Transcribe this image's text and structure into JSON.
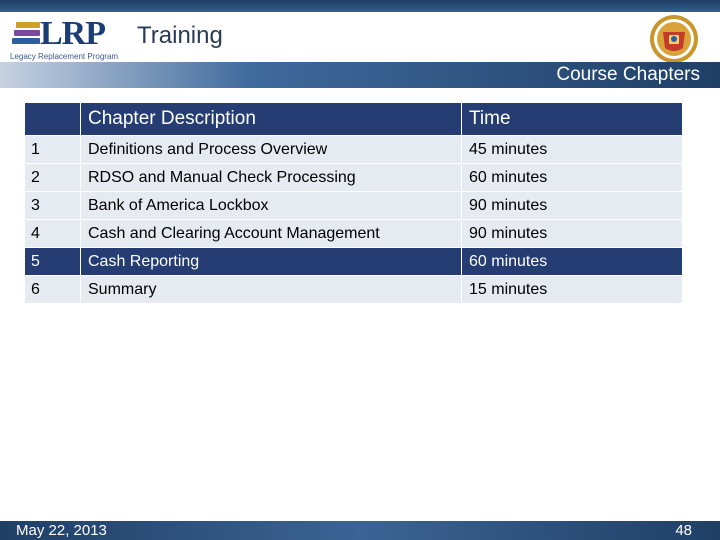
{
  "header": {
    "logo_text": "LRP",
    "logo_subtext": "Legacy Replacement Program",
    "title": "Training"
  },
  "subtitle": "Course Chapters",
  "table": {
    "columns": [
      "",
      "Chapter Description",
      "Time"
    ],
    "rows": [
      {
        "num": "1",
        "description": "Definitions and Process Overview",
        "time": "45 minutes"
      },
      {
        "num": "2",
        "description": "RDSO and Manual Check Processing",
        "time": "60 minutes"
      },
      {
        "num": "3",
        "description": "Bank of America Lockbox",
        "time": "90 minutes"
      },
      {
        "num": "4",
        "description": "Cash and Clearing Account Management",
        "time": "90 minutes"
      },
      {
        "num": "5",
        "description": "Cash Reporting",
        "time": "60 minutes"
      },
      {
        "num": "6",
        "description": "Summary",
        "time": "15 minutes"
      }
    ],
    "highlighted_row": 5
  },
  "footer": {
    "date": "May 22, 2013",
    "page": "48"
  },
  "colors": {
    "header_navy": "#253d73",
    "row_light": "#e6eaf1",
    "bar_blue": "#1f3f66"
  }
}
